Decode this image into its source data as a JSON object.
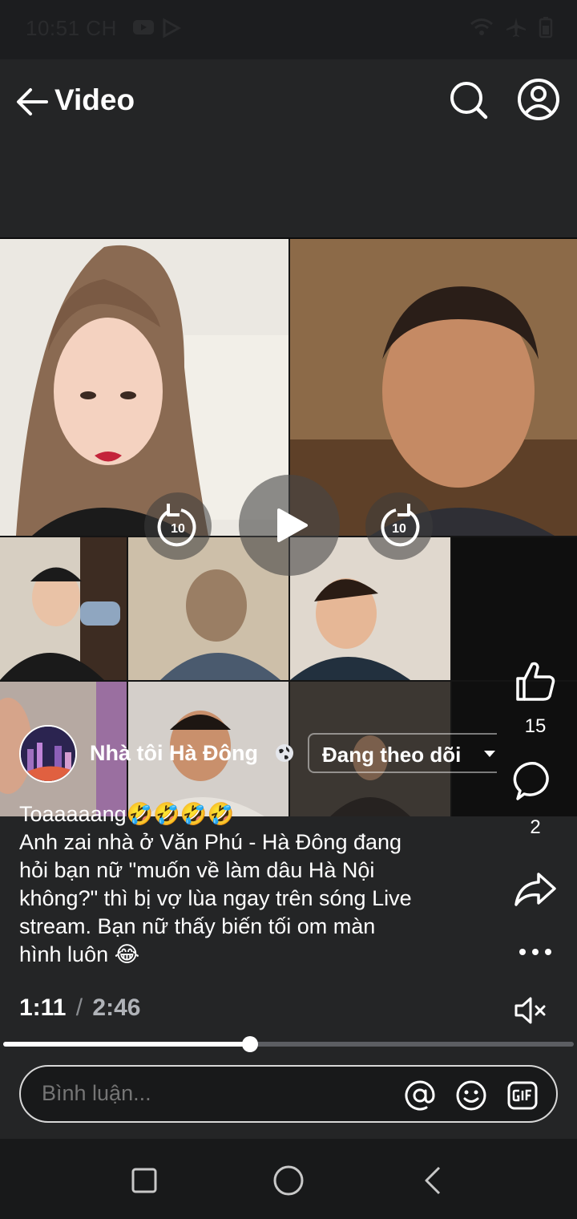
{
  "status_bar": {
    "time": "10:51 CH"
  },
  "app_bar": {
    "title": "Video"
  },
  "video": {
    "rewind_label": "10",
    "forward_label": "10"
  },
  "actions": {
    "like_count": "15",
    "comment_count": "2"
  },
  "post": {
    "author_name": "Nhà tôi Hà Đông",
    "follow_label": "Đang theo dõi",
    "caption_lines": [
      "Toaaaaang🤣🤣🤣🤣",
      "Anh zai nhà ở Văn Phú - Hà Đông đang",
      "hỏi bạn nữ \"muốn về làm dâu Hà Nội",
      "không?\" thì bị vợ lùa ngay trên sóng Live",
      "stream. Bạn nữ thấy biến tối om màn",
      "hình luôn 😂"
    ]
  },
  "playback": {
    "current_time": "1:11",
    "separator": "/",
    "total_time": "2:46",
    "progress_fraction": 0.433
  },
  "comment": {
    "placeholder": "Bình luận..."
  },
  "colors": {
    "background": "#242526",
    "status_bar": "#1c1d1f",
    "accent_white": "#ffffff",
    "progress_track": "#5c5e62"
  }
}
